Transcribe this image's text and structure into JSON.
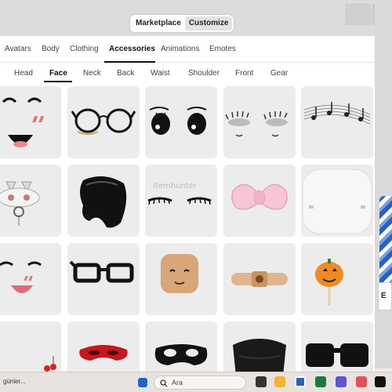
{
  "header": {
    "mode_tabs": [
      {
        "label": "Marketplace",
        "active": false
      },
      {
        "label": "Customize",
        "active": true
      }
    ]
  },
  "category_tabs": [
    {
      "label": "Avatars"
    },
    {
      "label": "Body"
    },
    {
      "label": "Clothing"
    },
    {
      "label": "Accessories",
      "active": true
    },
    {
      "label": "Animations"
    },
    {
      "label": "Emotes"
    }
  ],
  "sub_tabs": [
    {
      "label": "Head"
    },
    {
      "label": "Face",
      "active": true
    },
    {
      "label": "Neck"
    },
    {
      "label": "Back"
    },
    {
      "label": "Waist"
    },
    {
      "label": "Shoulder"
    },
    {
      "label": "Front"
    },
    {
      "label": "Gear"
    }
  ],
  "grid": {
    "items": [
      {
        "icon": "cute-face-icon"
      },
      {
        "icon": "round-glasses-icon"
      },
      {
        "icon": "anime-eyes-icon"
      },
      {
        "icon": "lashes-eyes-icon"
      },
      {
        "icon": "music-notes-icon"
      },
      {
        "icon": "cat-mask-icon"
      },
      {
        "icon": "black-hair-icon"
      },
      {
        "icon": "eyelashes-icon"
      },
      {
        "icon": "pink-bow-icon"
      },
      {
        "icon": "white-head-icon"
      },
      {
        "icon": "happy-face-icon"
      },
      {
        "icon": "black-glasses-icon"
      },
      {
        "icon": "smiling-head-icon"
      },
      {
        "icon": "bandage-icon"
      },
      {
        "icon": "pumpkin-lollipop-icon"
      },
      {
        "icon": "red-ornament-icon"
      },
      {
        "icon": "red-mask-icon"
      },
      {
        "icon": "black-eye-mask-icon"
      },
      {
        "icon": "black-face-mask-icon"
      },
      {
        "icon": "black-sunglasses-icon"
      }
    ],
    "watermark": "itemhunter"
  },
  "background": {
    "side_label": "E"
  },
  "taskbar": {
    "news_text": "günler...",
    "search_placeholder": "Ara"
  },
  "colors": {
    "accent": "#111111",
    "card_bg": "#ececec",
    "panel_bg": "#ffffff"
  }
}
